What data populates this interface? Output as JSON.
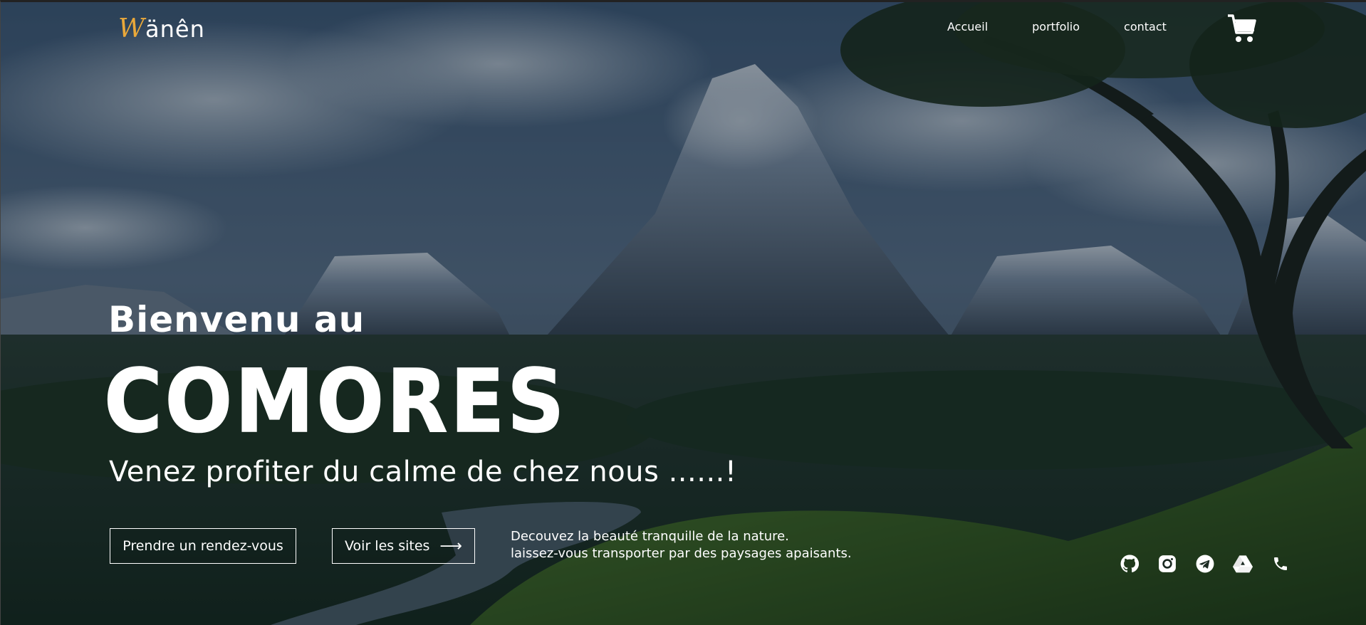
{
  "brand": {
    "logo_initial": "W",
    "logo_rest": "änên",
    "accent_color": "#e9a83a"
  },
  "nav": {
    "items": [
      {
        "label": "Accueil"
      },
      {
        "label": "portfolio"
      },
      {
        "label": "contact"
      }
    ],
    "cart_icon": "shopping-cart-icon"
  },
  "hero": {
    "welcome": "Bienvenu au",
    "title": "COMORES",
    "tagline": "Venez profiter du calme de chez nous ......!",
    "buttons": {
      "appointment": "Prendre un rendez-vous",
      "sites": "Voir les sites",
      "sites_arrow": "⟶"
    },
    "description": {
      "line1": "Decouvez la beauté tranquille de la nature.",
      "line2": "laissez-vous transporter par des paysages apaisants."
    }
  },
  "socials": [
    {
      "icon": "github-icon"
    },
    {
      "icon": "instagram-icon"
    },
    {
      "icon": "telegram-icon"
    },
    {
      "icon": "google-drive-icon"
    },
    {
      "icon": "phone-icon"
    }
  ]
}
